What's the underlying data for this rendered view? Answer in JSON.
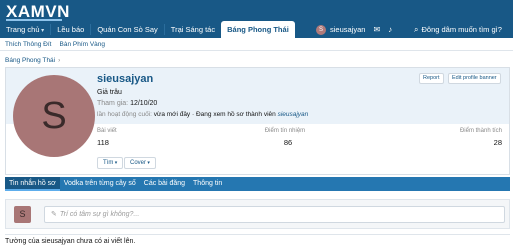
{
  "header": {
    "logo": "XAMVN",
    "nav": [
      {
        "label": "Trang chủ",
        "caret": true,
        "active": false
      },
      {
        "label": "Lều báo",
        "caret": false,
        "active": false
      },
      {
        "label": "Quán Con Sò Say",
        "caret": false,
        "active": false
      },
      {
        "label": "Trại Sáng tác",
        "caret": false,
        "active": false
      },
      {
        "label": "Báng Phong Thái",
        "caret": false,
        "active": true
      }
    ],
    "user": {
      "avatar_letter": "S",
      "name": "sieusajyan"
    },
    "icons": [
      "envelope-icon",
      "bell-icon"
    ],
    "search_label": "Đông dâm muốn tìm gì?"
  },
  "subnav": [
    "Thích Thông Đít",
    "Bàn Phím Vàng"
  ],
  "breadcrumb": {
    "label": "Báng Phong Thái"
  },
  "profile": {
    "avatar_letter": "S",
    "username": "sieusajyan",
    "title": "Giả trâu",
    "joined_label": "Tham gia:",
    "joined_value": "12/10/20",
    "lastseen_label": "lần hoạt động cuối:",
    "lastseen_value": "vừa mới đây",
    "lastseen_activity": "· Đang xem hồ sơ thành viên",
    "lastseen_link": "sieusajyan",
    "buttons": {
      "report": "Report",
      "edit_banner": "Edit profile banner"
    },
    "stats": [
      {
        "label": "Bài viết",
        "value": "118"
      },
      {
        "label": "Điểm tín nhiệm",
        "value": "86"
      },
      {
        "label": "Điểm thành tích",
        "value": "28"
      }
    ],
    "actions": {
      "find": "Tìm",
      "cover": "Cover"
    }
  },
  "tabs": [
    "Tin nhắn hồ sơ",
    "Vodka trên từng cây số",
    "Các bài đăng",
    "Thông tin"
  ],
  "status": {
    "avatar_letter": "S",
    "placeholder": "Trí có tâm sự gì không?..."
  },
  "empty_message": "Tường của sieusajyan chưa có ai viết lên."
}
